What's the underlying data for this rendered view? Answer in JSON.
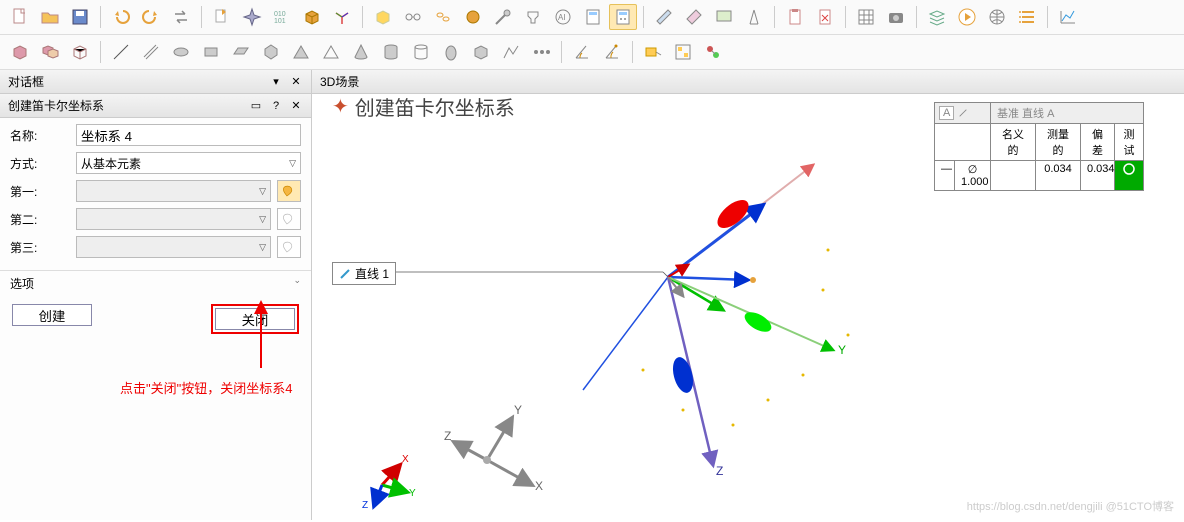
{
  "toolbar_row1_icons": [
    "new-file",
    "open-file",
    "save",
    "undo",
    "redo",
    "switch",
    "import",
    "spark",
    "binary",
    "cube",
    "axis-dropdown",
    "box-yellow",
    "link",
    "chain",
    "sphere",
    "probe",
    "tool",
    "ai",
    "calc",
    "calc2",
    "plane1",
    "plane2",
    "plane3",
    "compass",
    "clipboard",
    "stamp",
    "grid",
    "camera",
    "layers",
    "play",
    "globe",
    "list",
    "chart"
  ],
  "toolbar_row2_icons": [
    "cube1",
    "cube2",
    "cube3",
    "line",
    "multi",
    "disc",
    "rect",
    "rect2",
    "poly",
    "tri",
    "tri2",
    "cone",
    "cyl",
    "cyl2",
    "egg",
    "cube4",
    "path",
    "joints",
    "angle1",
    "angle2",
    "tag1",
    "tag2",
    "tag3"
  ],
  "panel": {
    "dialog_title": "对话框",
    "sub_title": "创建笛卡尔坐标系",
    "name_label": "名称:",
    "name_value": "坐标系 4",
    "method_label": "方式:",
    "method_value": "从基本元素",
    "first_label": "第一:",
    "second_label": "第二:",
    "third_label": "第三:",
    "options_label": "选项",
    "create_btn": "创建",
    "close_btn": "关闭"
  },
  "annotation": "点击\"关闭\"按钮，关闭坐标系4",
  "view": {
    "title": "3D场景",
    "heading": "创建笛卡尔坐标系",
    "line_label": "直线 1",
    "datum_label": "基准 直线 A"
  },
  "measure": {
    "hdr_a": "A",
    "col1": "名义的",
    "col2": "测量的",
    "col3": "偏差",
    "col4": "测试",
    "sym": "∅",
    "nominal": "1.000",
    "measured": "0.034",
    "dev": "0.034"
  },
  "axes": {
    "x": "X",
    "y": "Y",
    "z": "Z"
  },
  "watermark": "https://blog.csdn.net/dengjili @51CTO博客"
}
